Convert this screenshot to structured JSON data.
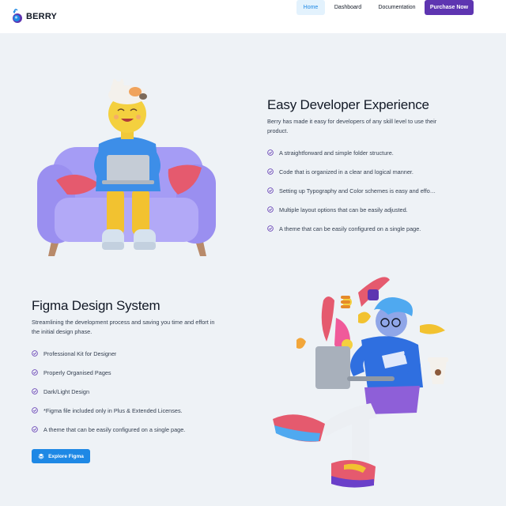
{
  "header": {
    "brand": "BERRY",
    "nav": {
      "home": "Home",
      "dashboard": "Dashboard",
      "documentation": "Documentation",
      "purchase": "Purchase Now"
    }
  },
  "developer_section": {
    "title": "Easy Developer Experience",
    "description": "Berry has made it easy for developers of any skill level to use their product.",
    "features": [
      "A straightforward and simple folder structure.",
      "Code that is organized in a clear and logical manner.",
      "Setting up Typography and Color schemes is easy and effo…",
      "Multiple layout options that can be easily adjusted.",
      "A theme that can be easily configured on a single page."
    ]
  },
  "figma_section": {
    "title": "Figma Design System",
    "description": "Streamlining the development process and saving you time and effort in the initial design phase.",
    "features": [
      "Professional Kit for Designer",
      "Properly Organised Pages",
      "Dark/Light Design",
      "*Figma file included only in Plus & Extended Licenses.",
      "A theme that can be easily configured on a single page."
    ],
    "button_label": "Explore Figma"
  },
  "colors": {
    "primary": "#1e88e5",
    "secondary": "#5e35b1",
    "background": "#eef2f6"
  }
}
